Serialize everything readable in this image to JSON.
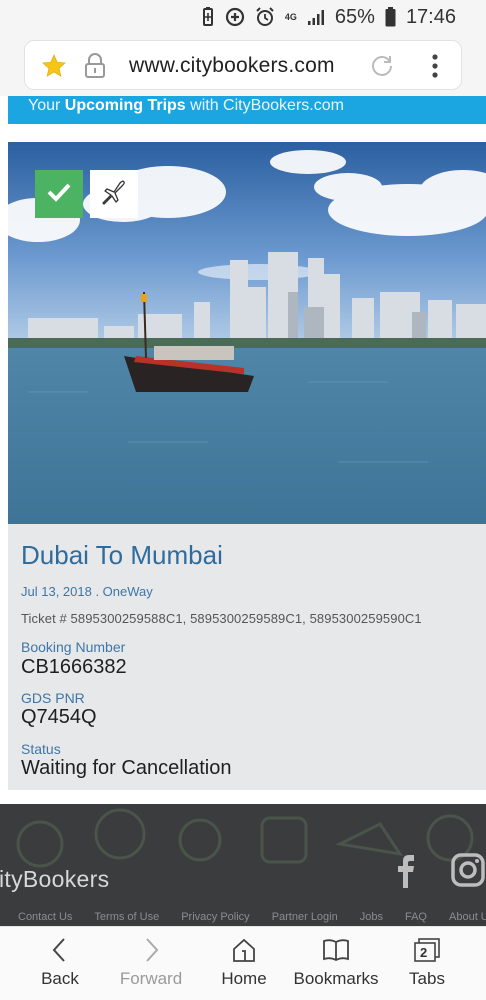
{
  "status_bar": {
    "network": "4G",
    "battery": "65%",
    "time": "17:46"
  },
  "browser": {
    "url": "www.citybookers.com"
  },
  "banner": {
    "prefix": "Your ",
    "highlight": "Upcoming Trips",
    "suffix": " with CityBookers.com"
  },
  "trip": {
    "title": "Dubai To Mumbai",
    "date": "Jul 13, 2018 . OneWay",
    "tickets": "Ticket # 5895300259588C1, 5895300259589C1, 5895300259590C1",
    "booking_number_label": "Booking Number",
    "booking_number": "CB1666382",
    "gds_pnr_label": "GDS PNR",
    "gds_pnr": "Q7454Q",
    "status_label": "Status",
    "status": "Waiting for Cancellation"
  },
  "footer": {
    "logo": "ityBookers",
    "links": [
      "Contact Us",
      "Terms of Use",
      "Privacy Policy",
      "Partner Login",
      "Jobs",
      "FAQ",
      "About Us"
    ]
  },
  "toolbar": {
    "back": "Back",
    "forward": "Forward",
    "home": "Home",
    "bookmarks": "Bookmarks",
    "tabs": "Tabs",
    "tab_count": "2"
  },
  "colors": {
    "banner": "#1ba6e2",
    "title": "#2f6c9e",
    "check": "#4cb363",
    "footer": "#3a3c3e"
  },
  "icons": [
    "battery-saver-icon",
    "data-saver-icon",
    "alarm-icon",
    "signal-icon",
    "battery-icon",
    "star-icon",
    "lock-icon",
    "reload-icon",
    "menu-icon",
    "check-icon",
    "plane-icon",
    "facebook-icon",
    "instagram-icon",
    "back-icon",
    "forward-icon",
    "home-icon",
    "bookmarks-icon",
    "tabs-icon"
  ]
}
